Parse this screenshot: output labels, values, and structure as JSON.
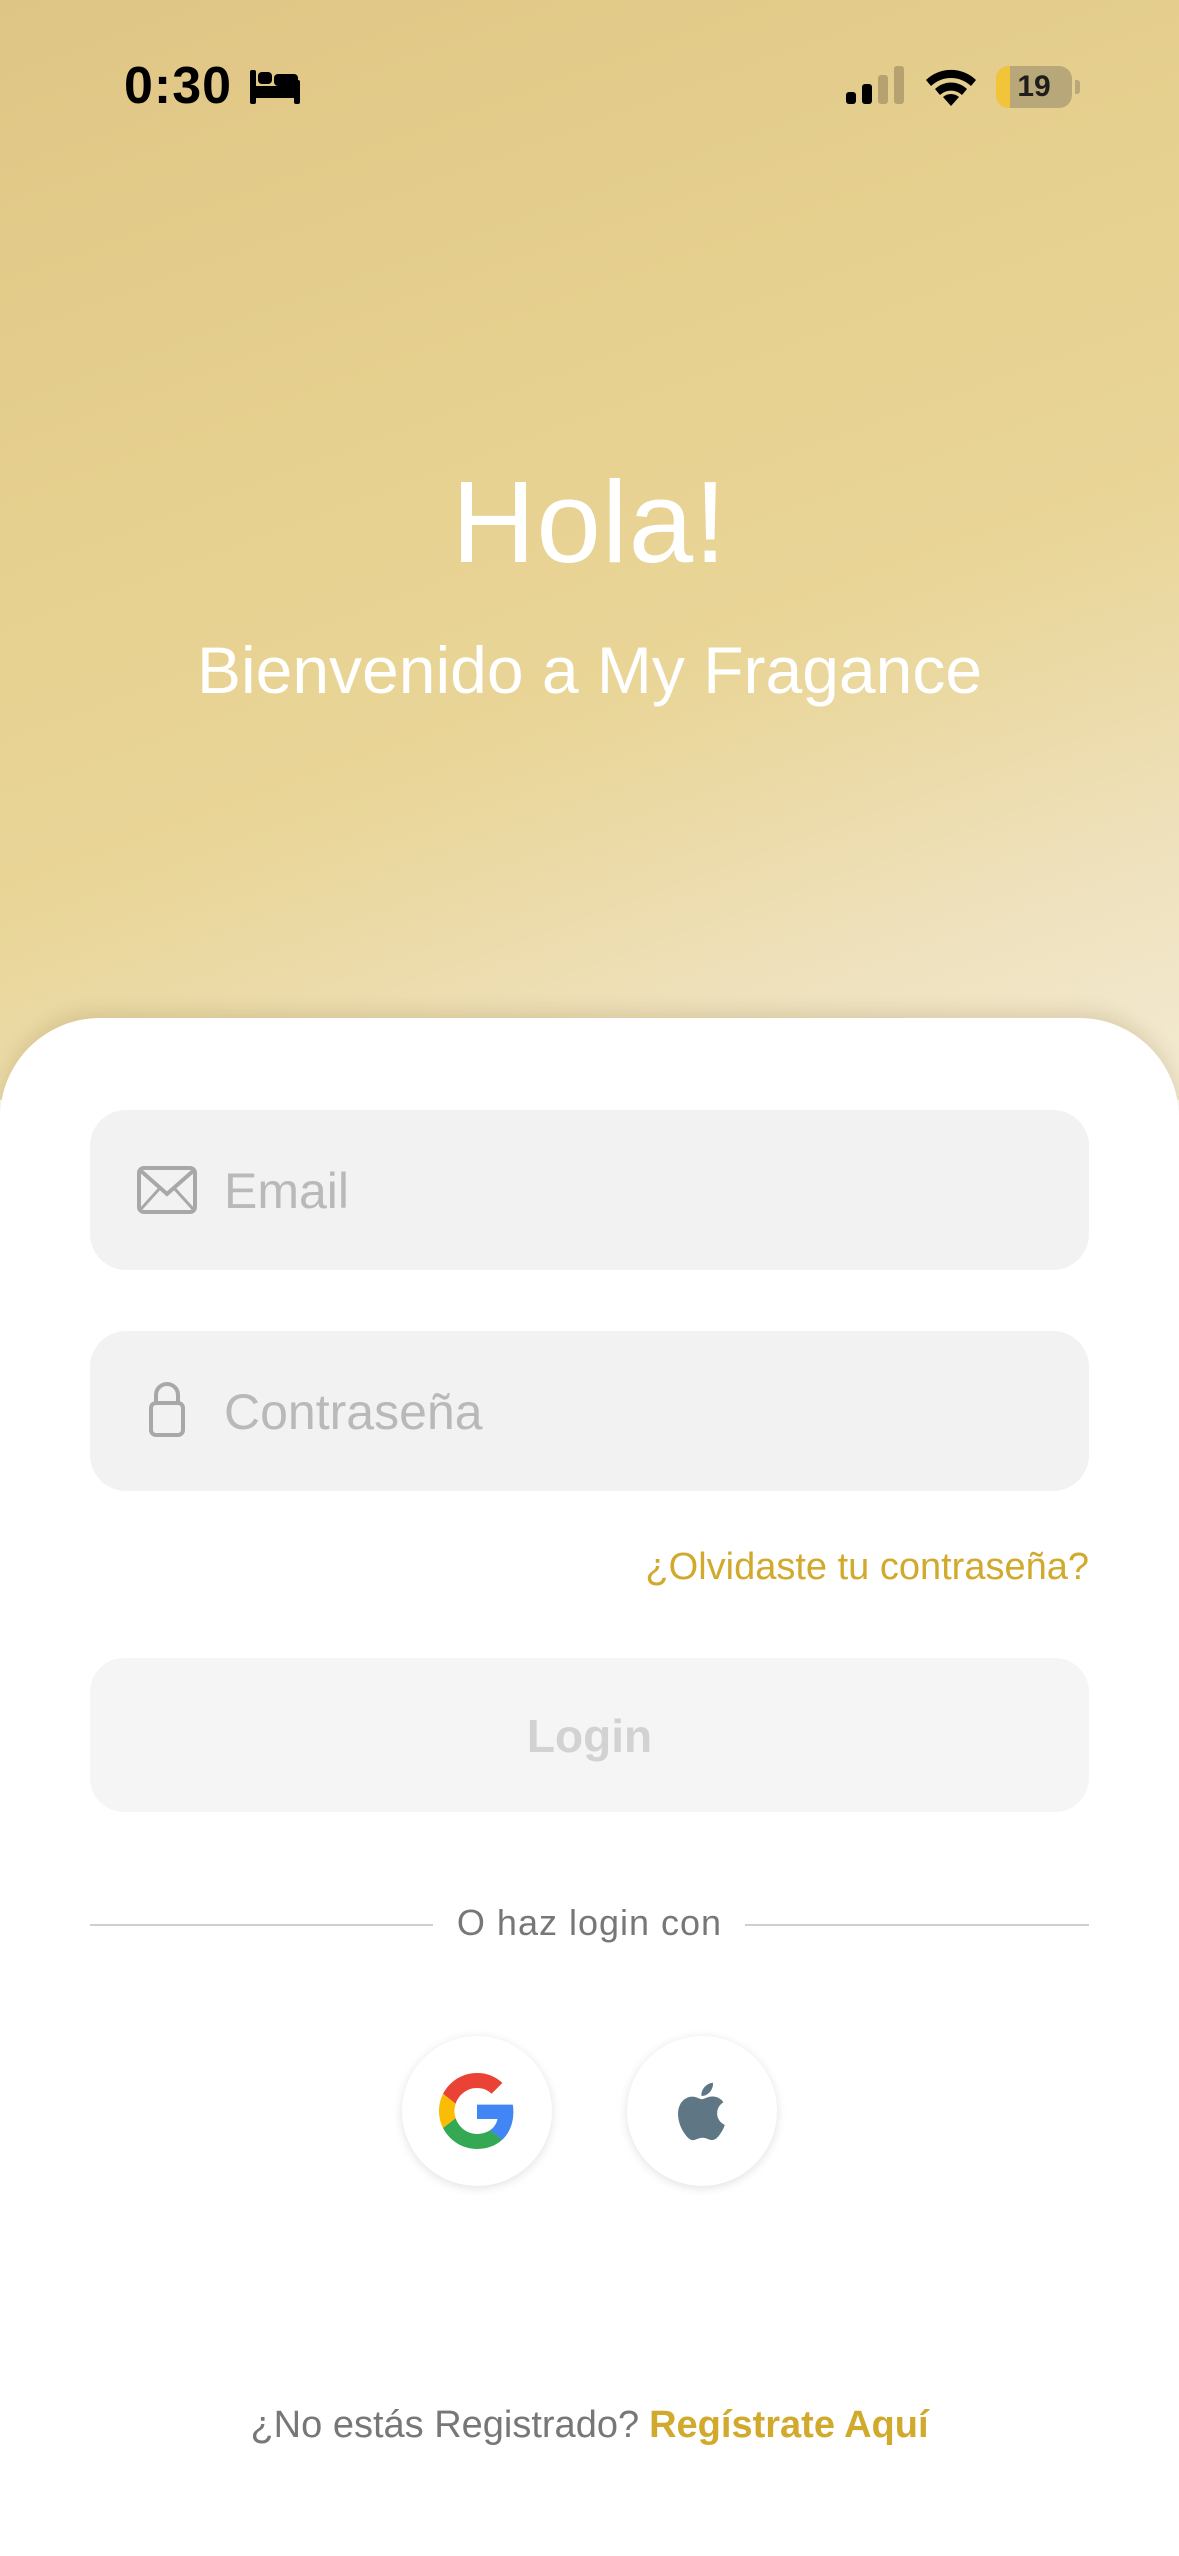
{
  "status_bar": {
    "time": "0:30",
    "focus_icon": "bed-icon",
    "battery_level": "19",
    "battery_fraction": 0.19,
    "colors": {
      "battery_fill": "#f2c43a"
    }
  },
  "header": {
    "greeting": "Hola!",
    "welcome": "Bienvenido a My Fragance"
  },
  "form": {
    "email": {
      "placeholder": "Email",
      "value": "",
      "icon": "envelope-icon"
    },
    "password": {
      "placeholder": "Contraseña",
      "value": "",
      "icon": "lock-icon"
    },
    "forgot_label": "¿Olvidaste tu contraseña?",
    "login_label": "Login"
  },
  "social": {
    "divider_label": "O haz login con",
    "providers": [
      {
        "name": "Google",
        "icon": "google-icon"
      },
      {
        "name": "Apple",
        "icon": "apple-icon"
      }
    ]
  },
  "footer": {
    "prompt": "¿No estás Registrado?",
    "register_label": "Regístrate Aquí"
  },
  "colors": {
    "accent": "#d1a92c",
    "hero_start": "#dfc585",
    "hero_end": "#f3ead2",
    "field_bg": "#f2f2f2"
  }
}
